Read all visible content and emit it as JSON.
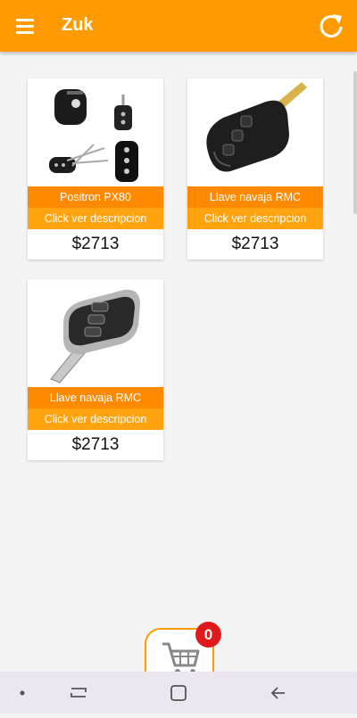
{
  "app": {
    "title": "Zuk"
  },
  "products": [
    {
      "name": "Positron PX80",
      "description_link": "Click ver descripcion",
      "price": "$2713"
    },
    {
      "name": "Llave navaja RMC",
      "description_link": "Click ver descripcion",
      "price": "$2713"
    },
    {
      "name": "Llave navaja RMC",
      "description_link": "Click ver descripcion",
      "price": "$2713"
    }
  ],
  "cart": {
    "count": "0"
  },
  "icons": {
    "menu": "menu-icon",
    "refresh": "refresh-icon",
    "cart": "shopping-cart-icon",
    "nav_dot": "dot-icon",
    "nav_recents": "recents-icon",
    "nav_home": "home-icon",
    "nav_back": "back-icon"
  },
  "colors": {
    "appbar": "#ff9a00",
    "name_band": "#ff8a00",
    "description_band": "#ffa30f",
    "badge": "#e01a1a",
    "navbar": "#ece6ee"
  }
}
